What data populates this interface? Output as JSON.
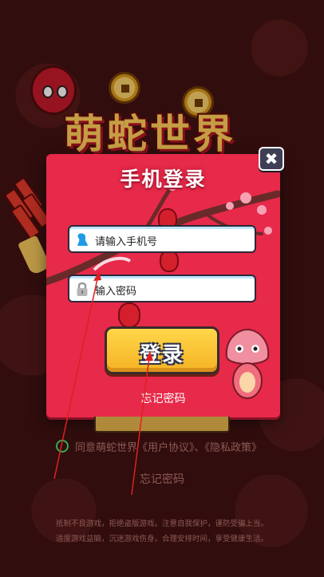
{
  "game": {
    "logo_text": "萌蛇世界"
  },
  "login_modal": {
    "title": "手机登录",
    "phone_placeholder": "请输入手机号",
    "password_placeholder": "输入密码",
    "login_button": "登录",
    "forgot_password": "忘记密码",
    "close_symbol": "✖"
  },
  "footer": {
    "agree_text": "同意萌蛇世界《用户协议》、《隐私政策》",
    "forgot_password": "忘记密码",
    "health_notice_line1": "抵制不良游戏，拒绝盗版游戏。注意自我保护，谨防受骗上当。",
    "health_notice_line2": "适度游戏益脑，沉迷游戏伤身。合理安排时间，享受健康生活。"
  },
  "icons": {
    "phone_field_icon": "user-silhouette-icon",
    "password_field_icon": "lock-icon",
    "close_icon": "close-icon"
  },
  "colors": {
    "modal_bg": "#e7294a",
    "login_button": "#ffd64a",
    "agree_radio": "#2fae55",
    "annotation_arrow": "#e02020"
  }
}
